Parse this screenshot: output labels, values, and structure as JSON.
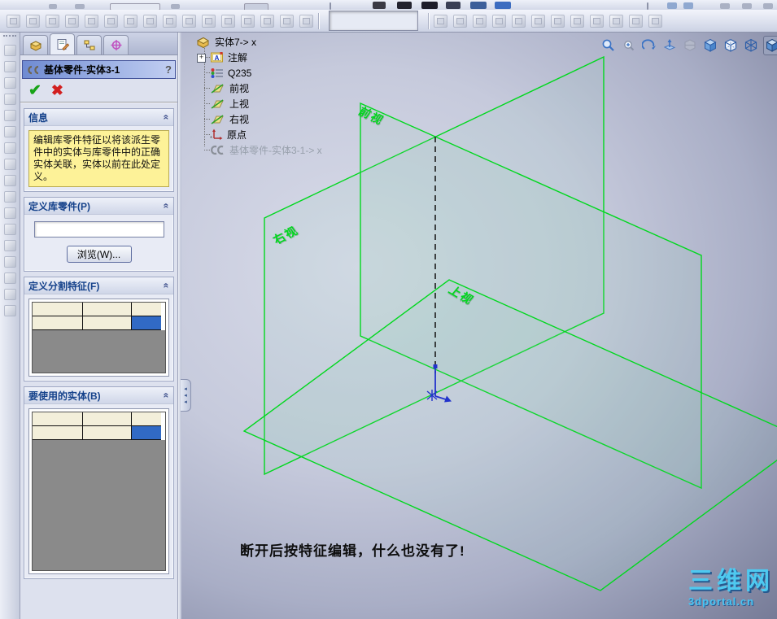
{
  "property_manager": {
    "tabs": [
      {
        "icon": "features-tab-icon"
      },
      {
        "icon": "property-manager-tab-icon"
      },
      {
        "icon": "configurations-tab-icon"
      },
      {
        "icon": "dimxpert-tab-icon"
      }
    ],
    "title": "基体零件-实体3-1",
    "help_label": "?",
    "groups": {
      "info": {
        "header": "信息",
        "message": "编辑库零件特征以将该派生零件中的实体与库零件中的正确实体关联，实体以前在此处定义。"
      },
      "library_part": {
        "header": "定义库零件(P)",
        "input_value": "",
        "browse_label": "浏览(W)..."
      },
      "split_feature": {
        "header": "定义分割特征(F)"
      },
      "bodies": {
        "header": "要使用的实体(B)"
      }
    }
  },
  "feature_tree": {
    "items": [
      {
        "label": "实体7-> x",
        "icon": "part-icon"
      },
      {
        "label": "注解",
        "icon": "annotations-folder-icon",
        "expander": "+"
      },
      {
        "label": "Q235",
        "icon": "material-icon"
      },
      {
        "label": "前视",
        "icon": "plane-icon"
      },
      {
        "label": "上视",
        "icon": "plane-icon"
      },
      {
        "label": "右视",
        "icon": "plane-icon"
      },
      {
        "label": "原点",
        "icon": "origin-icon"
      },
      {
        "label": "基体零件-实体3-1-> x",
        "icon": "library-feature-icon",
        "disabled": true
      }
    ]
  },
  "viewport": {
    "plane_labels": {
      "front": "前视",
      "right": "右视",
      "top": "上视"
    },
    "annotation": "断开后按特征编辑，什么也没有了!",
    "watermark": {
      "line1": "三维网",
      "line2": "3dportal.cn"
    },
    "colors": {
      "plane_line_green": "#00d81e",
      "selection_blue": "#316ac5",
      "info_yellow": "#fdf298",
      "origin_blue": "#2233cc"
    }
  },
  "heads_up_toolbar": {
    "icons": [
      "zoom-fit-icon",
      "zoom-area-icon",
      "rotate-view-icon",
      "normal-to-icon",
      "section-view-icon",
      "shaded-cube-icon",
      "hidden-lines-visible-icon",
      "wireframe-cube-icon",
      "view-orientation-icon",
      "appearance-icon"
    ]
  },
  "main_toolbar": {
    "icons_left": [
      "derived-part-icon",
      "attachment-icon",
      "compare-docs-icon",
      "move-copy-icon",
      "imported-picture-icon",
      "rollback-icon",
      "gears-icon",
      "wrap-icon",
      "sketch-star-icon",
      "gear-pair-icon",
      "split-part-icon",
      "join-icon",
      "stack-icon",
      "mirror-part-icon",
      "combine-icon",
      "cavity-icon"
    ],
    "icons_right": [
      "extrude-boss-icon",
      "extrude-cut-icon",
      "fillet-icon",
      "chamfer-icon",
      "shell-icon",
      "draft-icon",
      "hole-wizard-icon",
      "pattern-icon",
      "dome-icon",
      "rib-icon",
      "loft-icon",
      "revolve-icon"
    ]
  },
  "left_toolbar": {
    "icons": [
      "sketch-icon",
      "dimension-icon",
      "extrude-icon",
      "revolve-icon",
      "swept-icon",
      "lofted-icon",
      "fillet-tool-icon",
      "chamfer-tool-icon",
      "rib-tool-icon",
      "shell-tool-icon",
      "draft-tool-icon",
      "hole-icon",
      "mirror-icon",
      "pattern-tool-icon",
      "dome-tool-icon",
      "deform-icon",
      "shape-icon"
    ]
  }
}
